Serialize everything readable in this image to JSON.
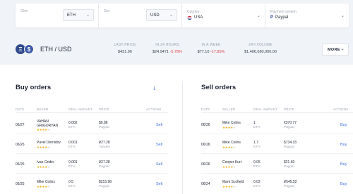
{
  "filters": {
    "give": {
      "label": "Give",
      "currency": "ETH"
    },
    "get": {
      "label": "Get",
      "currency": "USD"
    },
    "country": {
      "label": "Country",
      "value": "USA"
    },
    "payment": {
      "label": "Payment system",
      "value": "Paypal"
    }
  },
  "pair": {
    "title": "ETH / USD",
    "coin1_symbol": "Ξ",
    "coin2_symbol": "$",
    "stats": [
      {
        "label": "LAST PRICE",
        "value": "$431.96",
        "change": ""
      },
      {
        "label": "IN 24 HOURS",
        "value": "$24.9471",
        "change": "-5.78%"
      },
      {
        "label": "IN A WEEK",
        "value": "$77.10",
        "change": "-17.85%"
      },
      {
        "label": "24H VOLUME",
        "value": "$1,406,680,000.00",
        "change": ""
      }
    ],
    "more_label": "MORE"
  },
  "buy": {
    "title": "Buy orders",
    "headers": {
      "date": "DATE",
      "buyer": "BUYER",
      "amount": "DEAL AMOUNT",
      "price": "PRICE",
      "actions": "ACTIONS"
    },
    "rows": [
      {
        "date": "06/27",
        "name_1": "VAHAN",
        "name_2": "GRIGORYAN",
        "stars": 4,
        "amount": "0.002",
        "unit": "ETH",
        "price": "$0.86",
        "method": "Paypal",
        "action": "Sell"
      },
      {
        "date": "06/26",
        "name_1": "Pavel Dernidov",
        "name_2": "",
        "stars": 4,
        "amount": "0.001",
        "unit": "ETH",
        "price": "₽27.28",
        "method": "Yandex",
        "action": "Sell"
      },
      {
        "date": "06/26",
        "name_1": "Ivan Gridin",
        "name_2": "",
        "stars": 4,
        "amount": "0.001",
        "unit": "ETH",
        "price": "₽27.28",
        "method": "Paypal",
        "action": "Sell"
      },
      {
        "date": "06/25",
        "name_1": "Mike Colins",
        "name_2": "",
        "stars": 4,
        "amount": "0.5",
        "unit": "ETH",
        "price": "$215.98",
        "method": "Paypal",
        "action": "Sell"
      }
    ]
  },
  "sell": {
    "title": "Sell orders",
    "headers": {
      "date": "DATE",
      "seller": "SELLER",
      "amount": "DEAL AMOUNT",
      "price": "PRICE",
      "actions": "ACTIONS"
    },
    "rows": [
      {
        "date": "06/26",
        "name": "Mike Colins",
        "stars": 4,
        "amount": "1",
        "unit": "ETH",
        "price": "€370.77",
        "method": "Paypal",
        "action": "Buy"
      },
      {
        "date": "06/26",
        "name": "Mike Colins",
        "stars": 4,
        "amount": "1.7",
        "unit": "ETH",
        "price": "$734.33",
        "method": "Paypal",
        "action": "Buy"
      },
      {
        "date": "06/26",
        "name": "Cooper Kurt",
        "stars": 4,
        "amount": "0.05",
        "unit": "ETH",
        "price": "$21.60",
        "method": "Paypal",
        "action": "Buy"
      },
      {
        "date": "06/24",
        "name": "Mark Scofield",
        "stars": 4,
        "amount": "0.02",
        "unit": "ETH",
        "price": "₽545.52",
        "method": "Paypal",
        "action": "Buy"
      }
    ]
  },
  "colors": {
    "accent": "#3d6ee0",
    "negative": "#e0464f",
    "star": "#f2b01e"
  }
}
